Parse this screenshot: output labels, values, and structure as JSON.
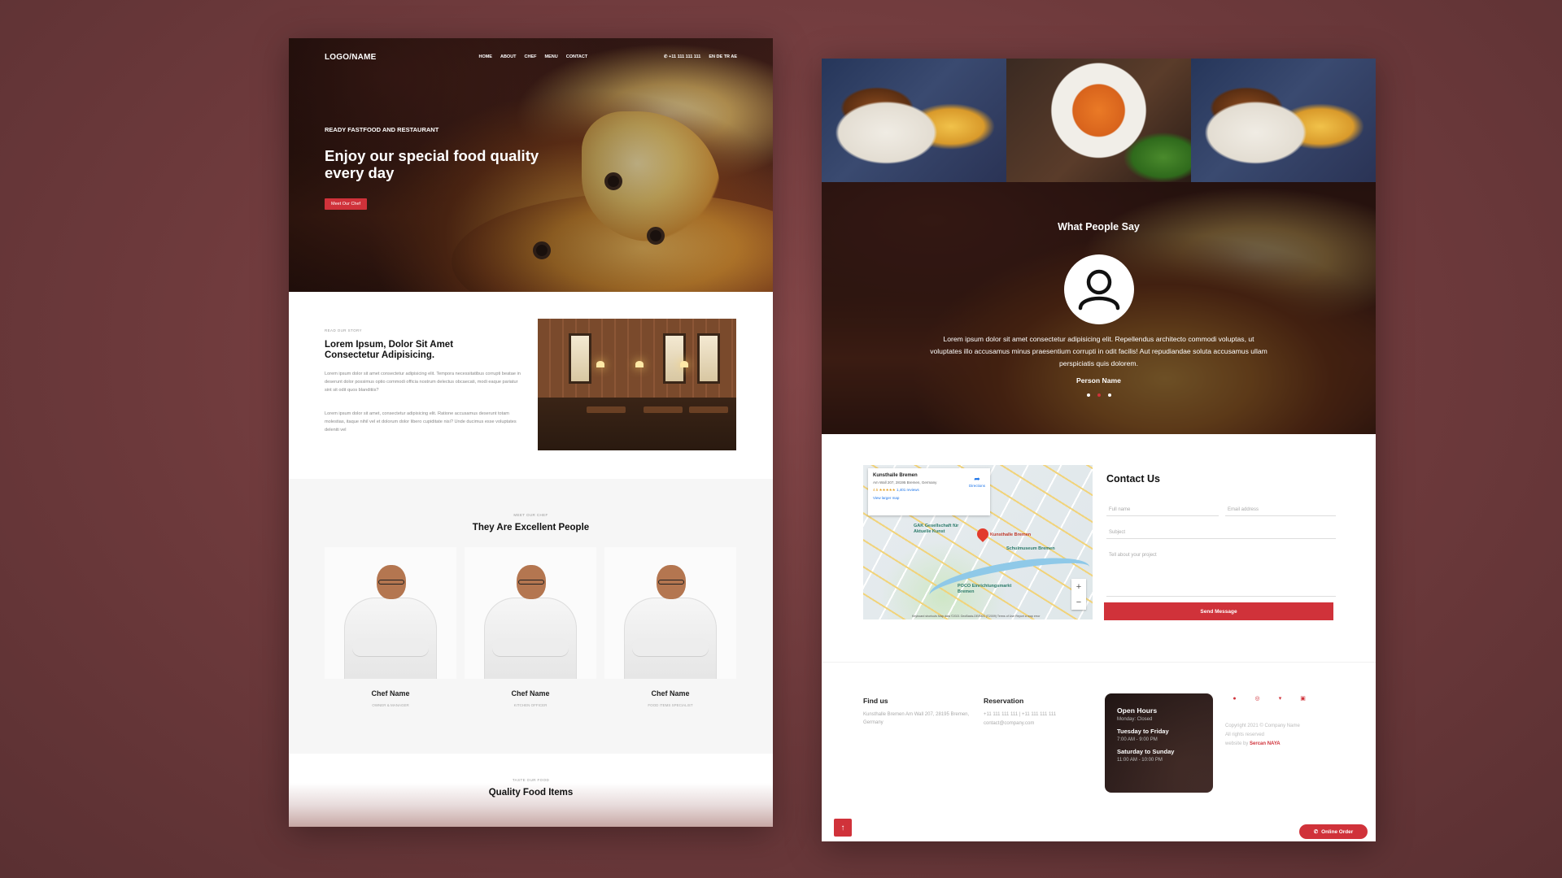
{
  "left_page": {
    "nav": {
      "logo": "LOGO/NAME",
      "menu": [
        "HOME",
        "ABOUT",
        "CHEF",
        "MENU",
        "CONTACT"
      ],
      "phone": "+11 111 111 111",
      "languages": "EN DE TR AE"
    },
    "hero": {
      "subtitle": "READY FASTFOOD AND RESTAURANT",
      "title": "Enjoy our special food quality every day",
      "button": "Meet Our Chef"
    },
    "story": {
      "label": "READ OUR STORY",
      "title": "Lorem Ipsum, Dolor Sit Amet Consectetur Adipisicing.",
      "para1": "Lorem ipsum dolor sit amet consectetur adipisicing elit. Tempora necessitatibus corrupti beatae in deserunt dolor possimus optio commodi officia nostrum delectus obcaecati, modi eaque pariatur sint sit odit quos blanditiis?",
      "para2": "Lorem ipsum dolor sit amet, consectetur adipisicing elit. Ratione accusamus deserunt totam molestias, itaque nihil vel et dolorum dolor libero cupiditate nisi? Unde ducimus esse voluptates deleniti vel"
    },
    "chefs": {
      "label": "MEET OUR CHEF",
      "title": "They Are Excellent People",
      "items": [
        {
          "name": "Chef Name",
          "role": "OWNER & MANAGER"
        },
        {
          "name": "Chef Name",
          "role": "KITCHEN OFFICER"
        },
        {
          "name": "Chef Name",
          "role": "FOOD ITEMS SPECIALIST"
        }
      ]
    },
    "food": {
      "label": "TASTE OUR FOOD",
      "title": "Quality Food Items"
    }
  },
  "right_page": {
    "testimonial": {
      "title": "What People Say",
      "quote": "Lorem ipsum dolor sit amet consectetur adipisicing elit. Repellendus architecto commodi voluptas, ut voluptates illo accusamus minus praesentium corrupti in odit facilis! Aut repudiandae soluta accusamus ullam perspiciatis quis dolorem.",
      "person": "Person Name",
      "dots": 3,
      "active_dot": 1
    },
    "map": {
      "place": "Kunsthalle Bremen",
      "address": "Am Wall 207, 28195 Bremen, Germany",
      "rating": "4.5 ★★★★★",
      "reviews": "1,401 reviews",
      "view_larger": "View larger map",
      "directions": "Directions",
      "pin_label": "Kunsthalle Bremen",
      "label_gak": "GAK Gesellschaft für Aktuelle Kunst",
      "label_museum": "Schulmuseum Bremen",
      "label_poco": "POCO Einrichtungsmarkt Bremen",
      "footer": "Keyboard shortcuts  Map data ©2021 GeoBasis-DE/BKG (©2009)  Terms of Use  Report a map error"
    },
    "contact": {
      "title": "Contact Us",
      "full_name": "Full name",
      "email": "Email address",
      "subject": "Subject",
      "message": "Tell about your project",
      "send": "Send Message"
    },
    "footer": {
      "find_us_title": "Find us",
      "find_us_text": "Kunsthalle Bremen Am Wall 207, 28195 Bremen, Germany",
      "reservation_title": "Reservation",
      "reservation_phone": "+11 111 111 111 | +11 111 111 111",
      "reservation_email": "contact@company.com",
      "hours_title": "Open Hours",
      "hours_monday": "Monday: Closed",
      "hours_day1": "Tuesday to Friday",
      "hours_time1": "7:00 AM - 9:00 PM",
      "hours_day2": "Saturday to Sunday",
      "hours_time2": "11:00 AM - 10:00 PM",
      "copyright": "Copyright 2021 © Company Name",
      "rights": "All rights reserved",
      "website_by": "website by",
      "author": "Sercan NAYA",
      "online_order": "Online Order"
    }
  },
  "colors": {
    "accent": "#d0323a",
    "background": "#6e3a3c"
  },
  "icons": [
    "phone-icon",
    "user-avatar-icon",
    "facebook-icon",
    "instagram-icon",
    "twitter-icon",
    "linkedin-icon",
    "arrow-up-icon",
    "whatsapp-icon",
    "directions-icon",
    "map-pin-icon"
  ]
}
